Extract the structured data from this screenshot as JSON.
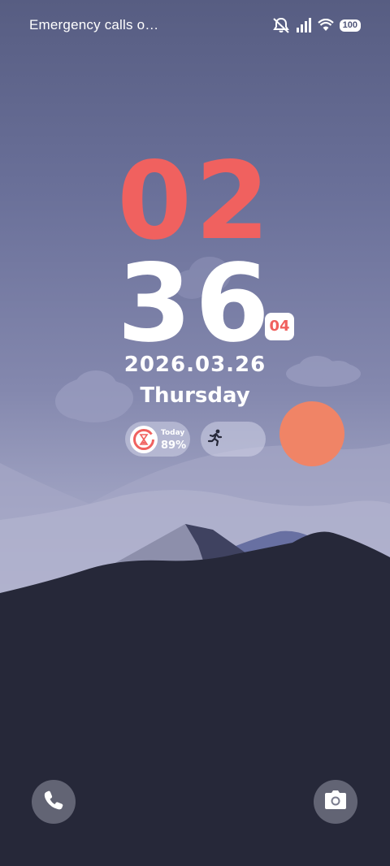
{
  "status_bar": {
    "carrier_text": "Emergency calls o…",
    "icons": [
      "silent-bell-icon",
      "signal-icon",
      "wifi-icon",
      "battery-icon"
    ],
    "battery_level": "100"
  },
  "clock": {
    "hour": "02",
    "minute": "36",
    "seconds": "04",
    "date": "2026.03.26",
    "weekday": "Thursday"
  },
  "widgets": {
    "screen_time": {
      "label": "Today",
      "value": "89%",
      "icon": "hourglass-icon"
    },
    "steps": {
      "icon": "running-person-icon"
    }
  },
  "shortcuts": {
    "left": {
      "icon": "phone-icon"
    },
    "right": {
      "icon": "camera-icon"
    }
  },
  "colors": {
    "hour_accent": "#f0615f",
    "sun": "#f08466",
    "foreground_mountain": "#262839"
  }
}
